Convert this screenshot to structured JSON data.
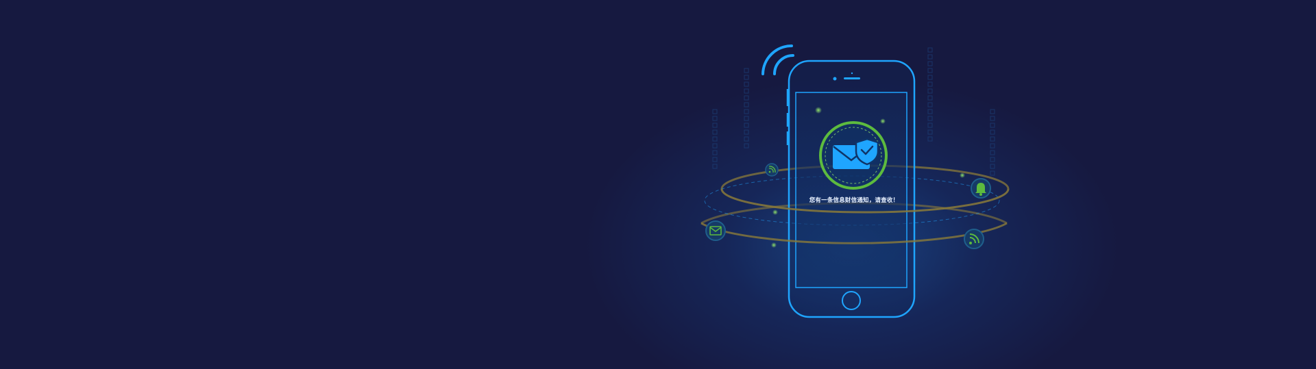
{
  "banner": {
    "message": "您有一条信息财信通知，请查收！",
    "colors": {
      "background": "#161940",
      "phone_outline": "#1fa5ff",
      "accent_green": "#5dbb3e",
      "ring_gold": "#8a7a3a"
    },
    "icons": {
      "signal": "wifi-signal-icon",
      "envelope": "envelope-icon",
      "shield": "shield-check-icon",
      "bell": "bell-icon",
      "rss_small": "rss-icon",
      "rss_large": "rss-icon",
      "mail_orbit": "envelope-icon"
    }
  }
}
